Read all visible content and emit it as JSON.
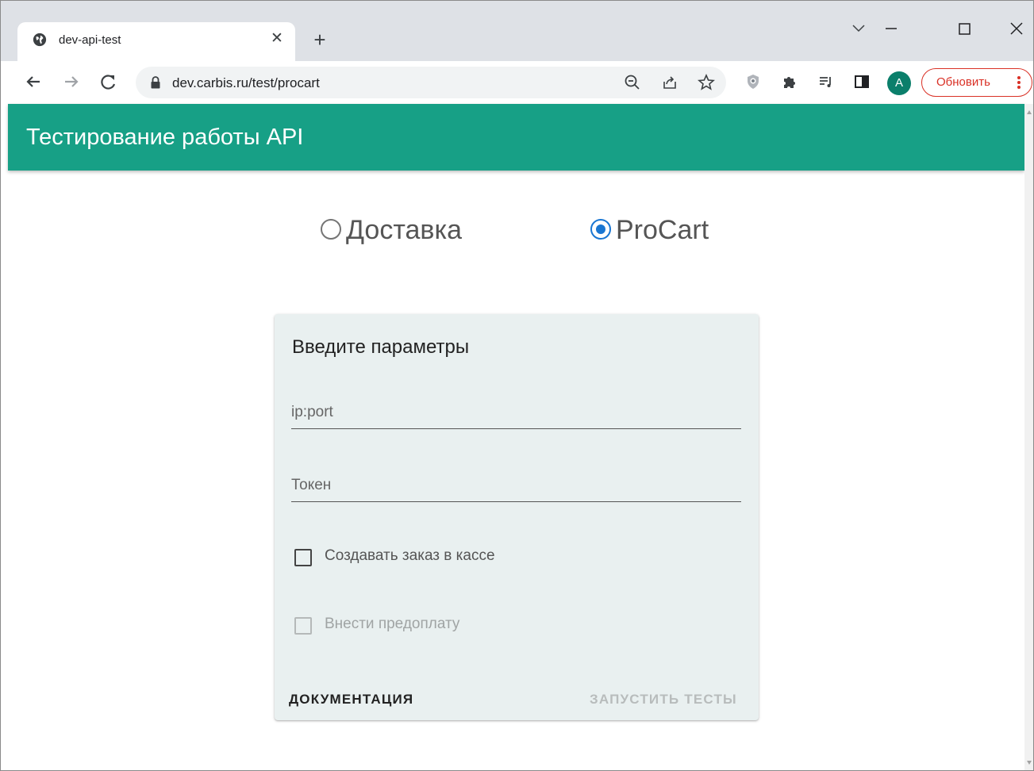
{
  "browser": {
    "tab_title": "dev-api-test",
    "url": "dev.carbis.ru/test/procart",
    "profile_initial": "A",
    "update_label": "Обновить"
  },
  "page": {
    "header_title": "Тестирование работы API",
    "mode_options": [
      {
        "label": "Доставка",
        "selected": false
      },
      {
        "label": "ProCart",
        "selected": true
      }
    ],
    "form": {
      "title": "Введите параметры",
      "ip_placeholder": "ip:port",
      "token_placeholder": "Токен",
      "create_order_label": "Создавать заказ в кассе",
      "create_order_checked": false,
      "prepay_label": "Внести предоплату",
      "prepay_checked": false,
      "prepay_disabled": true,
      "docs_button": "ДОКУМЕНТАЦИЯ",
      "run_button": "ЗАПУСТИТЬ ТЕСТЫ",
      "run_disabled": true
    }
  },
  "colors": {
    "appbar": "#17a086",
    "radio_selected": "#1976d2",
    "update_button": "#d93025"
  }
}
